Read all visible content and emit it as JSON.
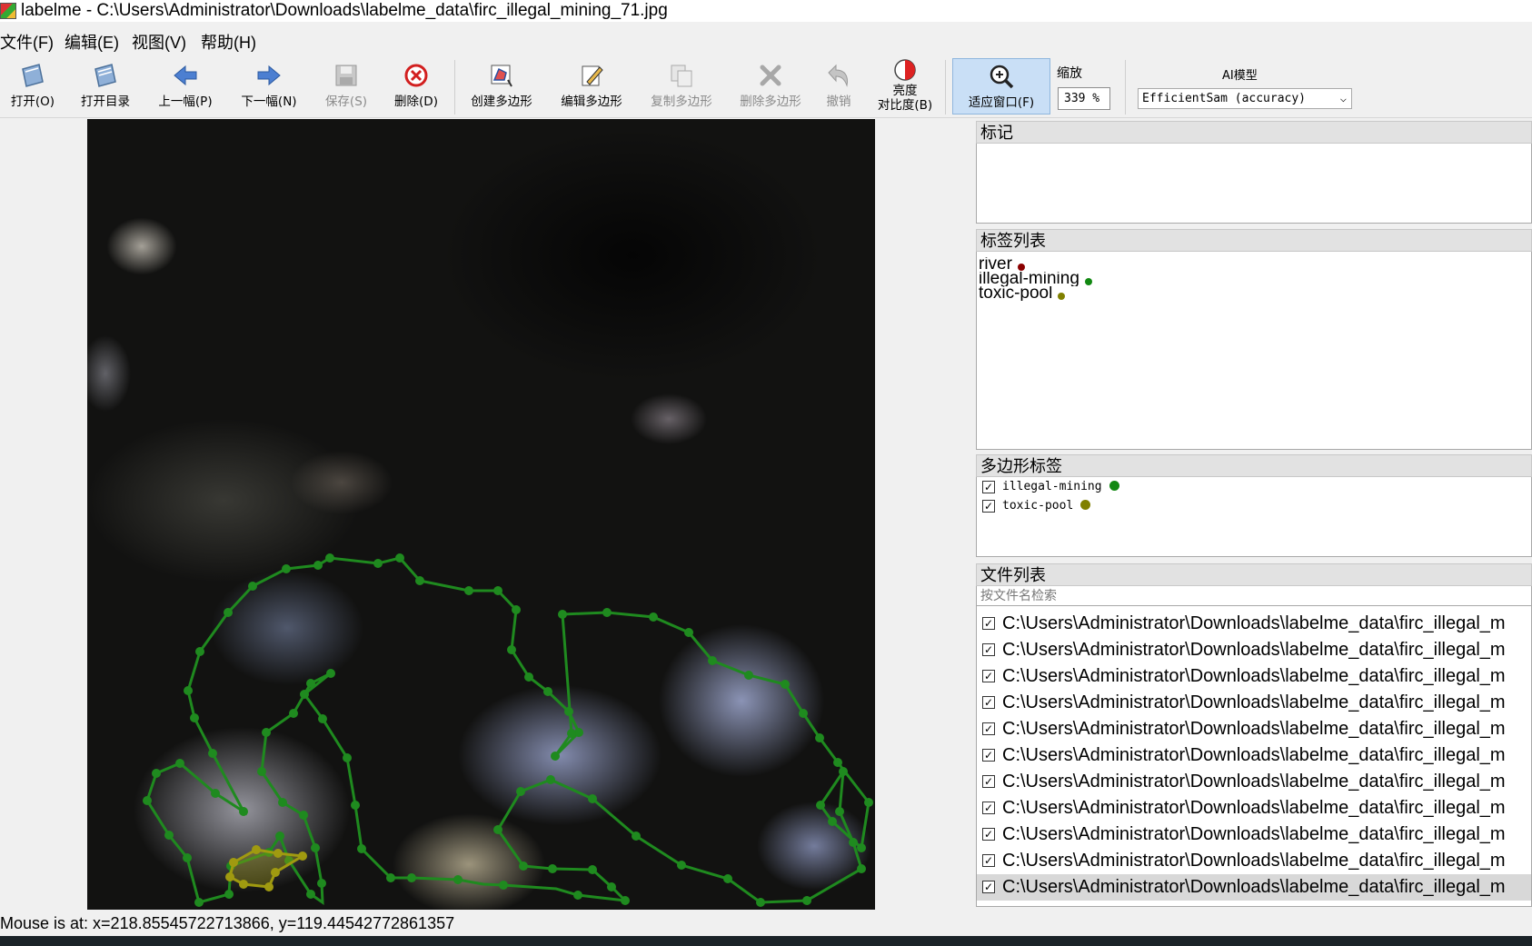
{
  "window": {
    "title": "labelme - C:\\Users\\Administrator\\Downloads\\labelme_data\\firc_illegal_mining_71.jpg"
  },
  "menu": [
    "文件(F)",
    "编辑(E)",
    "视图(V)",
    "帮助(H)"
  ],
  "toolbar": {
    "open": "打开(O)",
    "open_dir": "打开目录",
    "prev": "上一幅(P)",
    "next": "下一幅(N)",
    "save": "保存(S)",
    "delete": "删除(D)",
    "create_polygon": "创建多边形",
    "edit_polygon": "编辑多边形",
    "copy_polygon": "复制多边形",
    "delete_polygon": "删除多边形",
    "undo": "撤销",
    "brightness_line1": "亮度",
    "brightness_line2": "对比度(B)",
    "fit_window": "适应窗口(F)",
    "zoom_label": "缩放",
    "zoom_value": "339 %",
    "ai_label": "AI模型",
    "ai_model": "EfficientSam (accuracy)"
  },
  "panels": {
    "flags_title": "标记",
    "labels_title": "标签列表",
    "labels": [
      {
        "name": "river",
        "color": "#8b0000"
      },
      {
        "name": "illegal-mining",
        "color": "#118811"
      },
      {
        "name": "toxic-pool",
        "color": "#808000"
      }
    ],
    "polygons_title": "多边形标签",
    "polygons": [
      {
        "name": "illegal-mining",
        "color": "#118811",
        "checked": true
      },
      {
        "name": "toxic-pool",
        "color": "#808000",
        "checked": true
      }
    ],
    "files_title": "文件列表",
    "search_placeholder": "按文件名检索",
    "files": [
      "C:\\Users\\Administrator\\Downloads\\labelme_data\\firc_illegal_m",
      "C:\\Users\\Administrator\\Downloads\\labelme_data\\firc_illegal_m",
      "C:\\Users\\Administrator\\Downloads\\labelme_data\\firc_illegal_m",
      "C:\\Users\\Administrator\\Downloads\\labelme_data\\firc_illegal_m",
      "C:\\Users\\Administrator\\Downloads\\labelme_data\\firc_illegal_m",
      "C:\\Users\\Administrator\\Downloads\\labelme_data\\firc_illegal_m",
      "C:\\Users\\Administrator\\Downloads\\labelme_data\\firc_illegal_m",
      "C:\\Users\\Administrator\\Downloads\\labelme_data\\firc_illegal_m",
      "C:\\Users\\Administrator\\Downloads\\labelme_data\\firc_illegal_m",
      "C:\\Users\\Administrator\\Downloads\\labelme_data\\firc_illegal_m",
      "C:\\Users\\Administrator\\Downloads\\labelme_data\\firc_illegal_m"
    ]
  },
  "status": "Mouse is at: x=218.85545722713866, y=119.44542772861357",
  "colors": {
    "mining": "#1f8a1f",
    "toxic": "#a09a10"
  }
}
